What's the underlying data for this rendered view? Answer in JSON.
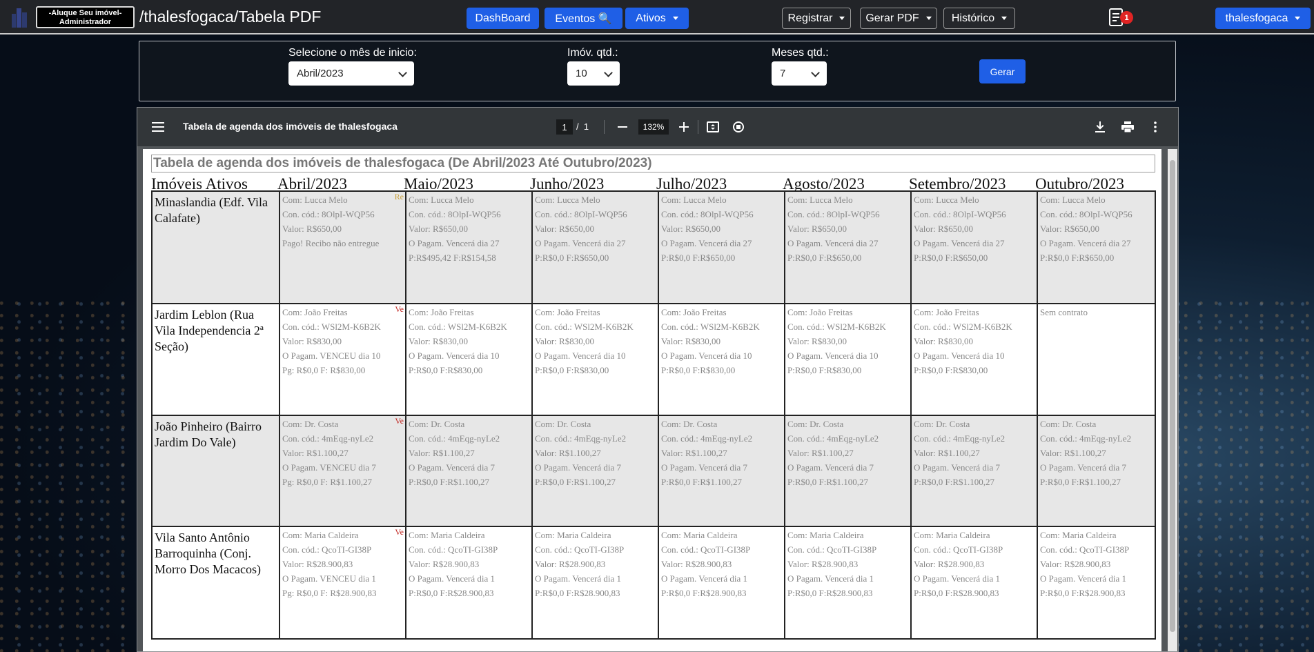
{
  "navbar": {
    "brand_line1": "-Aluque Seu imóvel-",
    "brand_line2": "Administrador",
    "path": "/thalesfogaca/Tabela PDF",
    "dashboard": "DashBoard",
    "eventos": "Eventos 🔍",
    "ativos": "Ativos",
    "registrar": "Registrar",
    "gerar_pdf": "Gerar PDF",
    "historico": "Histórico",
    "notif_count": "1",
    "user": "thalesfogaca"
  },
  "form": {
    "start_label": "Selecione o mês de inicio:",
    "start_value": "Abril/2023",
    "imov_label": "Imóv. qtd.:",
    "imov_value": "10",
    "meses_label": "Meses qtd.:",
    "meses_value": "7",
    "submit": "Gerar"
  },
  "viewer": {
    "title": "Tabela de agenda dos imóveis de thalesfogaca",
    "page_current": "1",
    "page_sep": "/",
    "page_total": "1",
    "zoom": "132%"
  },
  "document": {
    "title": "Tabela de agenda dos imóveis de thalesfogaca (De Abril/2023 Até Outubro/2023)",
    "headers": [
      "Imóveis Ativos",
      "Abril/2023",
      "Maio/2023",
      "Junho/2023",
      "Julho/2023",
      "Agosto/2023",
      "Setembro/2023",
      "Outubro/2023"
    ],
    "rows": [
      {
        "property": "Minaslandia (Edf. Vila Calafate)",
        "shaded": true,
        "cells": [
          {
            "tag": "Re",
            "tag_type": "re",
            "lines": [
              "Com: Lucca Melo",
              "Con. cód.: 8OlpI-WQP56",
              "Valor: R$650,00",
              "Pago! Recibo não entregue"
            ]
          },
          {
            "lines": [
              "Com: Lucca Melo",
              "Con. cód.: 8OlpI-WQP56",
              "Valor: R$650,00",
              "O Pagam. Vencerá dia 27",
              "P:R$495,42 F:R$154,58"
            ]
          },
          {
            "lines": [
              "Com: Lucca Melo",
              "Con. cód.: 8OlpI-WQP56",
              "Valor: R$650,00",
              "O Pagam. Vencerá dia 27",
              "P:R$0,0 F:R$650,00"
            ]
          },
          {
            "lines": [
              "Com: Lucca Melo",
              "Con. cód.: 8OlpI-WQP56",
              "Valor: R$650,00",
              "O Pagam. Vencerá dia 27",
              "P:R$0,0 F:R$650,00"
            ]
          },
          {
            "lines": [
              "Com: Lucca Melo",
              "Con. cód.: 8OlpI-WQP56",
              "Valor: R$650,00",
              "O Pagam. Vencerá dia 27",
              "P:R$0,0 F:R$650,00"
            ]
          },
          {
            "lines": [
              "Com: Lucca Melo",
              "Con. cód.: 8OlpI-WQP56",
              "Valor: R$650,00",
              "O Pagam. Vencerá dia 27",
              "P:R$0,0 F:R$650,00"
            ]
          },
          {
            "lines": [
              "Com: Lucca Melo",
              "Con. cód.: 8OlpI-WQP56",
              "Valor: R$650,00",
              "O Pagam. Vencerá dia 27",
              "P:R$0,0 F:R$650,00"
            ]
          }
        ]
      },
      {
        "property": "Jardim Leblon (Rua Vila Independencia 2ª Seção)",
        "shaded": false,
        "cells": [
          {
            "tag": "Ve",
            "tag_type": "ve",
            "lines": [
              "Com: João Freitas",
              "Con. cód.: WSl2M-K6B2K",
              "Valor: R$830,00",
              "O Pagam. VENCEU dia 10",
              "Pg: R$0,0 F: R$830,00"
            ]
          },
          {
            "lines": [
              "Com: João Freitas",
              "Con. cód.: WSl2M-K6B2K",
              "Valor: R$830,00",
              "O Pagam. Vencerá dia 10",
              "P:R$0,0 F:R$830,00"
            ]
          },
          {
            "lines": [
              "Com: João Freitas",
              "Con. cód.: WSl2M-K6B2K",
              "Valor: R$830,00",
              "O Pagam. Vencerá dia 10",
              "P:R$0,0 F:R$830,00"
            ]
          },
          {
            "lines": [
              "Com: João Freitas",
              "Con. cód.: WSl2M-K6B2K",
              "Valor: R$830,00",
              "O Pagam. Vencerá dia 10",
              "P:R$0,0 F:R$830,00"
            ]
          },
          {
            "lines": [
              "Com: João Freitas",
              "Con. cód.: WSl2M-K6B2K",
              "Valor: R$830,00",
              "O Pagam. Vencerá dia 10",
              "P:R$0,0 F:R$830,00"
            ]
          },
          {
            "lines": [
              "Com: João Freitas",
              "Con. cód.: WSl2M-K6B2K",
              "Valor: R$830,00",
              "O Pagam. Vencerá dia 10",
              "P:R$0,0 F:R$830,00"
            ]
          },
          {
            "lines": [
              "Sem contrato"
            ]
          }
        ]
      },
      {
        "property": "João Pinheiro (Bairro Jardim Do Vale)",
        "shaded": true,
        "cells": [
          {
            "tag": "Ve",
            "tag_type": "ve",
            "lines": [
              "Com: Dr. Costa",
              "Con. cód.: 4mEqg-nyLe2",
              "Valor: R$1.100,27",
              "O Pagam. VENCEU dia 7",
              "Pg: R$0,0 F: R$1.100,27"
            ]
          },
          {
            "lines": [
              "Com: Dr. Costa",
              "Con. cód.: 4mEqg-nyLe2",
              "Valor: R$1.100,27",
              "O Pagam. Vencerá dia 7",
              "P:R$0,0 F:R$1.100,27"
            ]
          },
          {
            "lines": [
              "Com: Dr. Costa",
              "Con. cód.: 4mEqg-nyLe2",
              "Valor: R$1.100,27",
              "O Pagam. Vencerá dia 7",
              "P:R$0,0 F:R$1.100,27"
            ]
          },
          {
            "lines": [
              "Com: Dr. Costa",
              "Con. cód.: 4mEqg-nyLe2",
              "Valor: R$1.100,27",
              "O Pagam. Vencerá dia 7",
              "P:R$0,0 F:R$1.100,27"
            ]
          },
          {
            "lines": [
              "Com: Dr. Costa",
              "Con. cód.: 4mEqg-nyLe2",
              "Valor: R$1.100,27",
              "O Pagam. Vencerá dia 7",
              "P:R$0,0 F:R$1.100,27"
            ]
          },
          {
            "lines": [
              "Com: Dr. Costa",
              "Con. cód.: 4mEqg-nyLe2",
              "Valor: R$1.100,27",
              "O Pagam. Vencerá dia 7",
              "P:R$0,0 F:R$1.100,27"
            ]
          },
          {
            "lines": [
              "Com: Dr. Costa",
              "Con. cód.: 4mEqg-nyLe2",
              "Valor: R$1.100,27",
              "O Pagam. Vencerá dia 7",
              "P:R$0,0 F:R$1.100,27"
            ]
          }
        ]
      },
      {
        "property": "Vila Santo Antônio Barroquinha (Conj. Morro Dos Macacos)",
        "shaded": false,
        "cells": [
          {
            "tag": "Ve",
            "tag_type": "ve",
            "lines": [
              "Com: Maria Caldeira",
              "Con. cód.: QcoTI-GI38P",
              "Valor: R$28.900,83",
              "O Pagam. VENCEU dia 1",
              "Pg: R$0,0 F: R$28.900,83"
            ]
          },
          {
            "lines": [
              "Com: Maria Caldeira",
              "Con. cód.: QcoTI-GI38P",
              "Valor: R$28.900,83",
              "O Pagam. Vencerá dia 1",
              "P:R$0,0 F:R$28.900,83"
            ]
          },
          {
            "lines": [
              "Com: Maria Caldeira",
              "Con. cód.: QcoTI-GI38P",
              "Valor: R$28.900,83",
              "O Pagam. Vencerá dia 1",
              "P:R$0,0 F:R$28.900,83"
            ]
          },
          {
            "lines": [
              "Com: Maria Caldeira",
              "Con. cód.: QcoTI-GI38P",
              "Valor: R$28.900,83",
              "O Pagam. Vencerá dia 1",
              "P:R$0,0 F:R$28.900,83"
            ]
          },
          {
            "lines": [
              "Com: Maria Caldeira",
              "Con. cód.: QcoTI-GI38P",
              "Valor: R$28.900,83",
              "O Pagam. Vencerá dia 1",
              "P:R$0,0 F:R$28.900,83"
            ]
          },
          {
            "lines": [
              "Com: Maria Caldeira",
              "Con. cód.: QcoTI-GI38P",
              "Valor: R$28.900,83",
              "O Pagam. Vencerá dia 1",
              "P:R$0,0 F:R$28.900,83"
            ]
          },
          {
            "lines": [
              "Com: Maria Caldeira",
              "Con. cód.: QcoTI-GI38P",
              "Valor: R$28.900,83",
              "O Pagam. Vencerá dia 1",
              "P:R$0,0 F:R$28.900,83"
            ]
          }
        ]
      }
    ]
  }
}
